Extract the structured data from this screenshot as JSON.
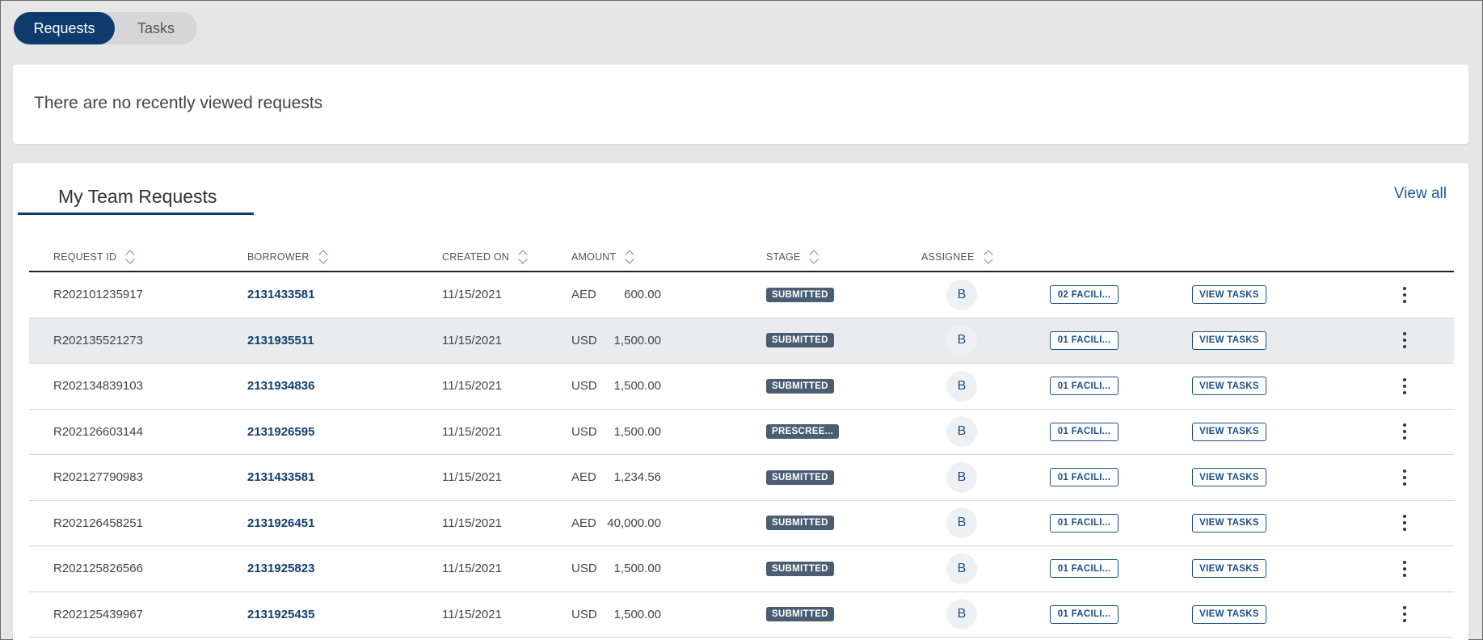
{
  "toggle": {
    "requests_label": "Requests",
    "tasks_label": "Tasks"
  },
  "recent": {
    "empty_message": "There are no recently viewed requests"
  },
  "team": {
    "tab_label": "My Team Requests",
    "view_all_label": "View all",
    "columns": [
      "REQUEST ID",
      "BORROWER",
      "CREATED ON",
      "AMOUNT",
      "STAGE",
      "ASSIGNEE"
    ],
    "rows": [
      {
        "request_id": "R202101235917",
        "borrower": "2131433581",
        "created_on": "11/15/2021",
        "currency": "AED",
        "amount": "600.00",
        "stage": "SUBMITTED",
        "assignee": "B",
        "facility": "02 FACILI...",
        "action": "VIEW TASKS"
      },
      {
        "request_id": "R202135521273",
        "borrower": "2131935511",
        "created_on": "11/15/2021",
        "currency": "USD",
        "amount": "1,500.00",
        "stage": "SUBMITTED",
        "assignee": "B",
        "facility": "01 FACILI...",
        "action": "VIEW TASKS"
      },
      {
        "request_id": "R202134839103",
        "borrower": "2131934836",
        "created_on": "11/15/2021",
        "currency": "USD",
        "amount": "1,500.00",
        "stage": "SUBMITTED",
        "assignee": "B",
        "facility": "01 FACILI...",
        "action": "VIEW TASKS"
      },
      {
        "request_id": "R202126603144",
        "borrower": "2131926595",
        "created_on": "11/15/2021",
        "currency": "USD",
        "amount": "1,500.00",
        "stage": "PRESCREE...",
        "assignee": "B",
        "facility": "01 FACILI...",
        "action": "VIEW TASKS"
      },
      {
        "request_id": "R202127790983",
        "borrower": "2131433581",
        "created_on": "11/15/2021",
        "currency": "AED",
        "amount": "1,234.56",
        "stage": "SUBMITTED",
        "assignee": "B",
        "facility": "01 FACILI...",
        "action": "VIEW TASKS"
      },
      {
        "request_id": "R202126458251",
        "borrower": "2131926451",
        "created_on": "11/15/2021",
        "currency": "AED",
        "amount": "40,000.00",
        "stage": "SUBMITTED",
        "assignee": "B",
        "facility": "01 FACILI...",
        "action": "VIEW TASKS"
      },
      {
        "request_id": "R202125826566",
        "borrower": "2131925823",
        "created_on": "11/15/2021",
        "currency": "USD",
        "amount": "1,500.00",
        "stage": "SUBMITTED",
        "assignee": "B",
        "facility": "01 FACILI...",
        "action": "VIEW TASKS"
      },
      {
        "request_id": "R202125439967",
        "borrower": "2131925435",
        "created_on": "11/15/2021",
        "currency": "USD",
        "amount": "1,500.00",
        "stage": "SUBMITTED",
        "assignee": "B",
        "facility": "01 FACILI...",
        "action": "VIEW TASKS"
      }
    ]
  },
  "colors": {
    "primary": "#0d3b6e",
    "link": "#123f70",
    "stage_badge": "#4a5d73",
    "background": "#e6e6e6"
  }
}
